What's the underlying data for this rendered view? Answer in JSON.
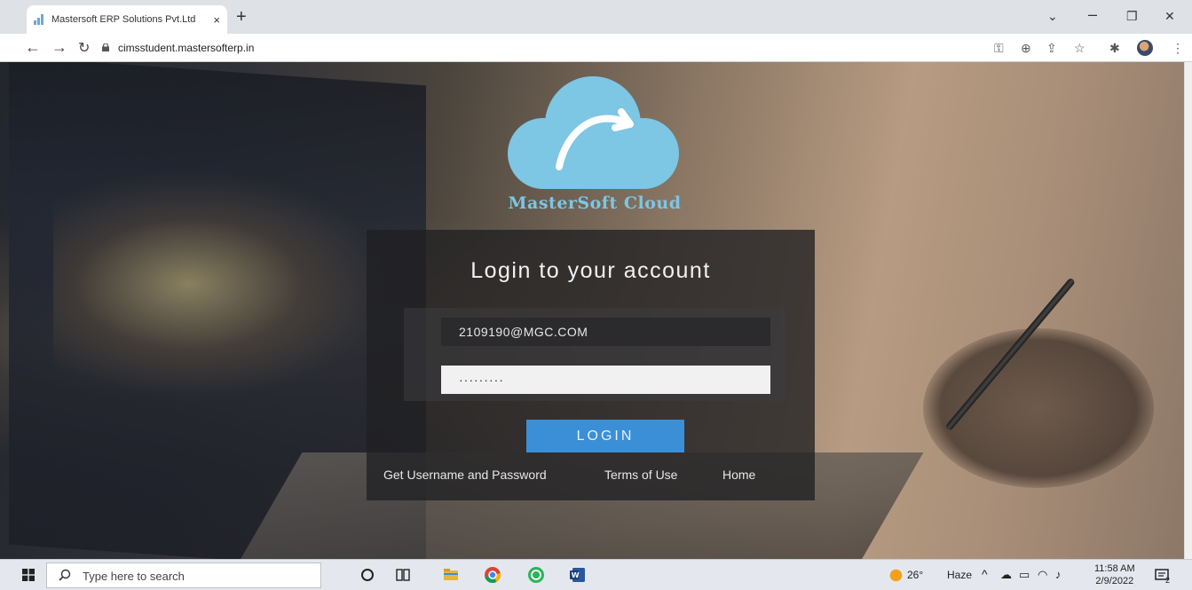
{
  "browser": {
    "tab_title": "Mastersoft ERP Solutions Pvt.Ltd",
    "close_tab_glyph": "×",
    "new_tab_glyph": "+",
    "url": "cimsstudent.mastersofterp.in"
  },
  "page": {
    "logo_text": "MasterSoft Cloud",
    "login_title": "Login to your account",
    "username_value": "2109190@MGC.COM",
    "password_mask": "·········",
    "login_button": "LOGIN",
    "links": {
      "get_credentials": "Get Username and Password",
      "terms": "Terms of Use",
      "home": "Home"
    }
  },
  "taskbar": {
    "search_placeholder": "Type here to search",
    "weather": "Haze",
    "weather_temp": "26°",
    "time": "11:58 AM",
    "date": "2/9/2022",
    "notifications_count": "2"
  },
  "colors": {
    "cloud_blue": "#7dc6e4",
    "login_button": "#3b8fd6"
  }
}
